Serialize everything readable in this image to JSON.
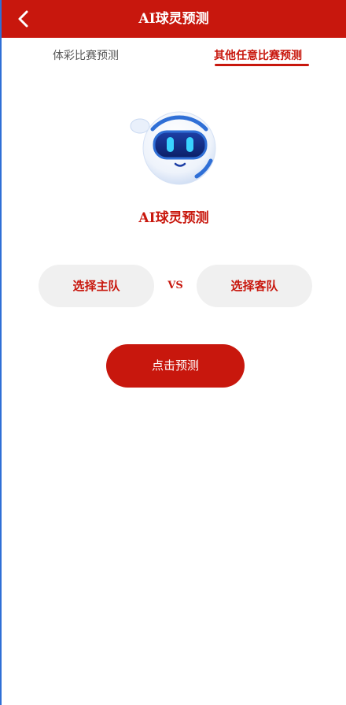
{
  "header": {
    "title": "AI球灵预测",
    "back_icon": "chevron-left-icon"
  },
  "tabs": [
    {
      "label": "体彩比赛预测",
      "active": false
    },
    {
      "label": "其他任意比赛预测",
      "active": true
    }
  ],
  "hero": {
    "icon": "robot-mascot-icon",
    "title": "AI球灵预测"
  },
  "match": {
    "home_label": "选择主队",
    "vs_label": "VS",
    "away_label": "选择客队"
  },
  "actions": {
    "predict_label": "点击预测"
  },
  "colors": {
    "brand_red": "#c8170d",
    "button_gray": "#f0f0f0",
    "robot_blue": "#2f6fd6"
  }
}
